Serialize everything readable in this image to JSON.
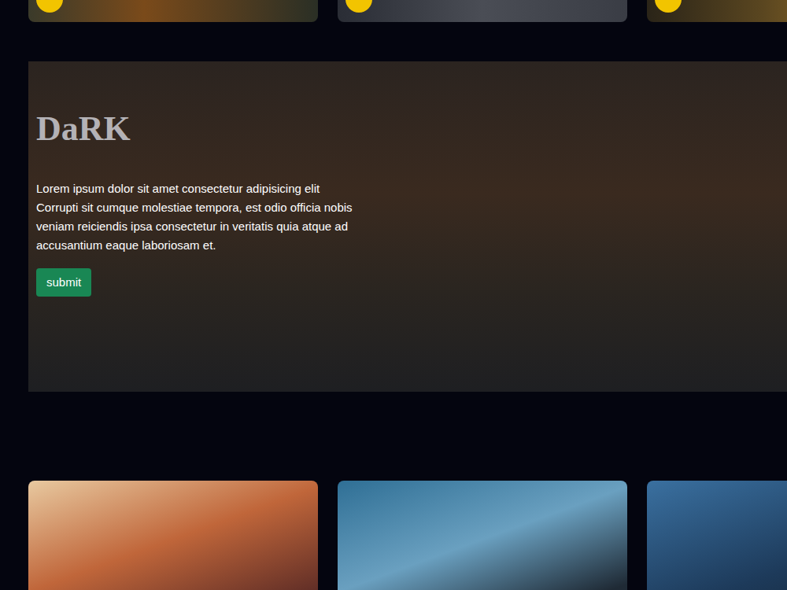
{
  "hero": {
    "title": "DaRK",
    "description": "Lorem ipsum dolor sit amet consectetur adipisicing elit Corrupti sit cumque molestiae tempora, est odio officia nobis veniam reiciendis ipsa consectetur in veritatis quia atque ad accusantium eaque laboriosam et.",
    "button": "submit"
  }
}
